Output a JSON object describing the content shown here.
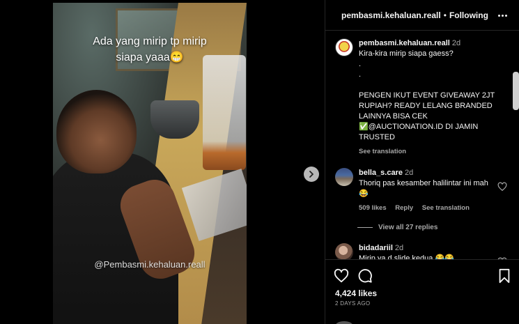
{
  "media": {
    "overlay_line1": "Ada yang mirip tp mirip",
    "overlay_line2": "siapa yaaa😁",
    "watermark": "@Pembasmi.kehaluan.reall"
  },
  "header": {
    "username": "pembasmi.kehaluan.reall",
    "separator": "•",
    "follow_label": "Following"
  },
  "caption": {
    "username": "pembasmi.kehaluan.reall",
    "time": "2d",
    "text": "Kira-kira mirip siapa gaess?\n.\n.\n\nPENGEN IKUT EVENT GIVEAWAY 2JT RUPIAH? READY LELANG BRANDED LAINNYA BISA CEK\n✅@AUCTIONATION.ID DI JAMIN TRUSTED",
    "see_translation": "See translation"
  },
  "comments": [
    {
      "username": "bella_s.care",
      "time": "2d",
      "text": "Thoriq pas kesamber halilintar ini mah 😂",
      "likes": "509 likes",
      "reply": "Reply",
      "see_translation": "See translation"
    },
    {
      "username": "bidadariil",
      "time": "2d",
      "text": "Mirip ya d slide kedua 😂😂"
    }
  ],
  "view_replies": "View all 27 replies",
  "actions": {
    "likes": "4,424 likes",
    "date": "2 DAYS AGO"
  }
}
